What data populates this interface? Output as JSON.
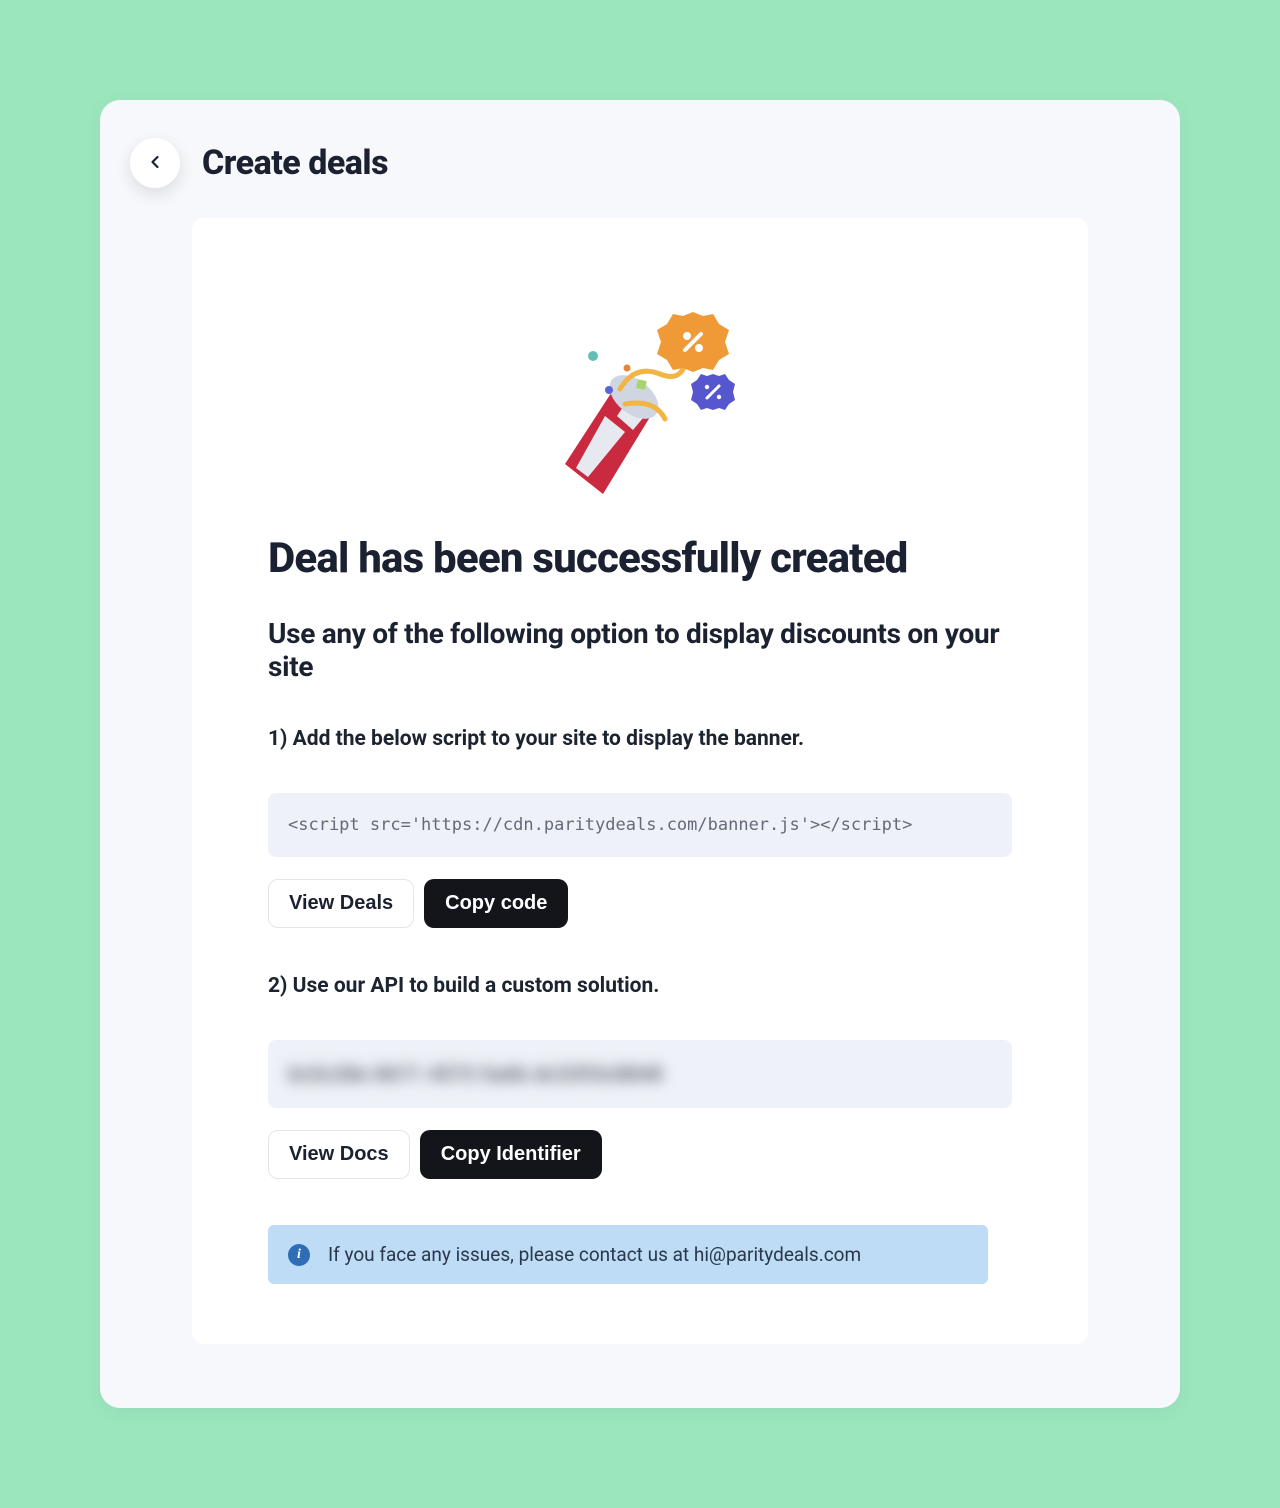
{
  "header": {
    "title": "Create deals"
  },
  "hero": {
    "title": "Deal has been successfully created",
    "subtitle": "Use any of the following option to display discounts on your site"
  },
  "step1": {
    "label": "1) Add the below script to your site to display the banner.",
    "code": "<script src='https://cdn.paritydeals.com/banner.js'></script>",
    "view_btn": "View Deals",
    "copy_btn": "Copy code"
  },
  "step2": {
    "label": "2) Use our API to build a custom solution.",
    "identifier_placeholder": "6c5c28e 8671 4573 5a6b dc3393c8848",
    "view_btn": "View Docs",
    "copy_btn": "Copy Identifier"
  },
  "info": {
    "text": "If you face any issues, please contact us at hi@paritydeals.com"
  }
}
